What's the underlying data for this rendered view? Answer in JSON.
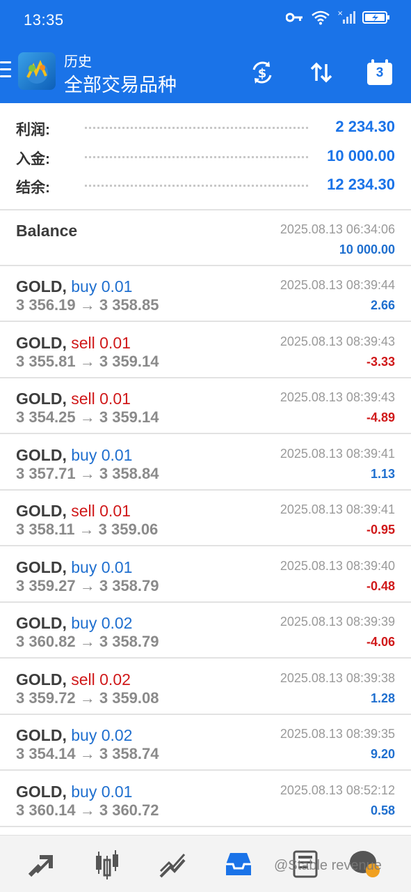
{
  "status": {
    "time": "13:35"
  },
  "header": {
    "subtitle": "历史",
    "title": "全部交易品种",
    "calendar_day": "3"
  },
  "summary": [
    {
      "label": "利润:",
      "value": "2 234.30"
    },
    {
      "label": "入金:",
      "value": "10 000.00"
    },
    {
      "label": "结余:",
      "value": "12 234.30"
    }
  ],
  "balance": {
    "label": "Balance",
    "time": "2025.08.13 06:34:06",
    "amount": "10 000.00"
  },
  "trades": [
    {
      "symbol": "GOLD,",
      "side": "buy 0.01",
      "type": "buy",
      "prices": "3 356.19 → 3 358.85",
      "time": "2025.08.13 08:39:44",
      "profit": "2.66",
      "sign": "pos"
    },
    {
      "symbol": "GOLD,",
      "side": "sell 0.01",
      "type": "sell",
      "prices": "3 355.81 → 3 359.14",
      "time": "2025.08.13 08:39:43",
      "profit": "-3.33",
      "sign": "neg"
    },
    {
      "symbol": "GOLD,",
      "side": "sell 0.01",
      "type": "sell",
      "prices": "3 354.25 → 3 359.14",
      "time": "2025.08.13 08:39:43",
      "profit": "-4.89",
      "sign": "neg"
    },
    {
      "symbol": "GOLD,",
      "side": "buy 0.01",
      "type": "buy",
      "prices": "3 357.71 → 3 358.84",
      "time": "2025.08.13 08:39:41",
      "profit": "1.13",
      "sign": "pos"
    },
    {
      "symbol": "GOLD,",
      "side": "sell 0.01",
      "type": "sell",
      "prices": "3 358.11 → 3 359.06",
      "time": "2025.08.13 08:39:41",
      "profit": "-0.95",
      "sign": "neg"
    },
    {
      "symbol": "GOLD,",
      "side": "buy 0.01",
      "type": "buy",
      "prices": "3 359.27 → 3 358.79",
      "time": "2025.08.13 08:39:40",
      "profit": "-0.48",
      "sign": "neg"
    },
    {
      "symbol": "GOLD,",
      "side": "buy 0.02",
      "type": "buy",
      "prices": "3 360.82 → 3 358.79",
      "time": "2025.08.13 08:39:39",
      "profit": "-4.06",
      "sign": "neg"
    },
    {
      "symbol": "GOLD,",
      "side": "sell 0.02",
      "type": "sell",
      "prices": "3 359.72 → 3 359.08",
      "time": "2025.08.13 08:39:38",
      "profit": "1.28",
      "sign": "pos"
    },
    {
      "symbol": "GOLD,",
      "side": "buy 0.02",
      "type": "buy",
      "prices": "3 354.14 → 3 358.74",
      "time": "2025.08.13 08:39:35",
      "profit": "9.20",
      "sign": "pos"
    },
    {
      "symbol": "GOLD,",
      "side": "buy 0.01",
      "type": "buy",
      "prices": "3 360.14 → 3 360.72",
      "time": "2025.08.13 08:52:12",
      "profit": "0.58",
      "sign": "pos"
    }
  ],
  "bottom_nav": {
    "items": [
      "quotes-icon",
      "chart-candles-icon",
      "trade-chart-icon",
      "history-icon",
      "news-icon",
      "chat-icon"
    ],
    "active": "history-icon"
  },
  "watermark": "@Stable revenue",
  "colors": {
    "accent": "#1a73e8",
    "buy": "#1f6fcf",
    "sell": "#d0191a"
  }
}
